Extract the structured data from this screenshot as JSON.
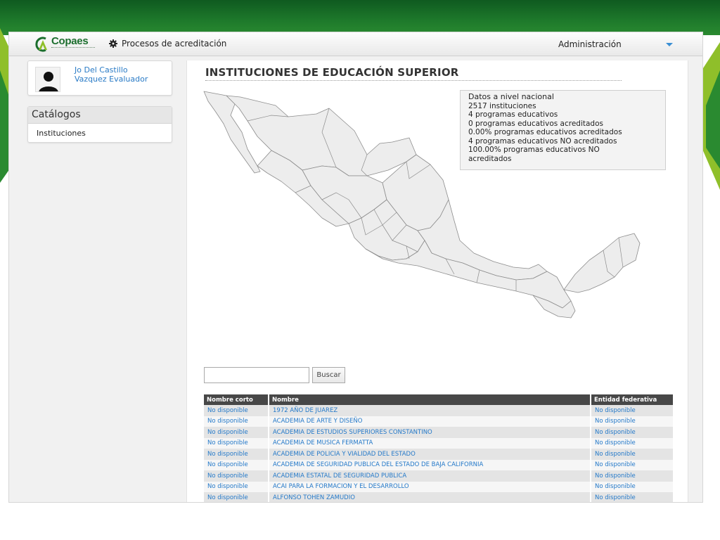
{
  "brand": {
    "name": "Copaes"
  },
  "navbar": {
    "procesos_label": "Procesos de acreditación",
    "admin_label": "Administración"
  },
  "user": {
    "name_line1": "Jo Del Castillo",
    "name_line2": "Vazquez Evaluador"
  },
  "sidebar": {
    "section_title": "Catálogos",
    "items": [
      {
        "label": "Instituciones"
      }
    ]
  },
  "main": {
    "title": "INSTITUCIONES DE EDUCACIÓN SUPERIOR"
  },
  "info": {
    "title": "Datos a nivel nacional",
    "lines": [
      "2517 instituciones",
      "4 programas educativos",
      "0 programas educativos acreditados",
      "0.00% programas educativos acreditados",
      "4 programas educativos NO acreditados",
      "100.00% programas educativos NO",
      "acreditados"
    ]
  },
  "search": {
    "value": "",
    "button_label": "Buscar"
  },
  "table": {
    "headers": [
      "Nombre corto",
      "Nombre",
      "Entidad federativa"
    ],
    "rows": [
      [
        "No disponible",
        "1972 AÑO DE JUAREZ",
        "No disponible"
      ],
      [
        "No disponible",
        "ACADEMIA DE ARTE Y DISEÑO",
        "No disponible"
      ],
      [
        "No disponible",
        "ACADEMIA DE ESTUDIOS SUPERIORES CONSTANTINO",
        "No disponible"
      ],
      [
        "No disponible",
        "ACADEMIA DE MUSICA FERMATTA",
        "No disponible"
      ],
      [
        "No disponible",
        "ACADEMIA DE POLICIA Y VIALIDAD DEL ESTADO",
        "No disponible"
      ],
      [
        "No disponible",
        "ACADEMIA DE SEGURIDAD PUBLICA DEL ESTADO DE BAJA CALIFORNIA",
        "No disponible"
      ],
      [
        "No disponible",
        "ACADEMIA ESTATAL DE SEGURIDAD PUBLICA",
        "No disponible"
      ],
      [
        "No disponible",
        "ACAI PARA LA FORMACION Y EL DESARROLLO",
        "No disponible"
      ],
      [
        "No disponible",
        "ALFONSO TOHEN ZAMUDIO",
        "No disponible"
      ]
    ]
  },
  "colors": {
    "accent_green": "#1e7a2b",
    "link_blue": "#2479c9",
    "table_header": "#474747"
  }
}
